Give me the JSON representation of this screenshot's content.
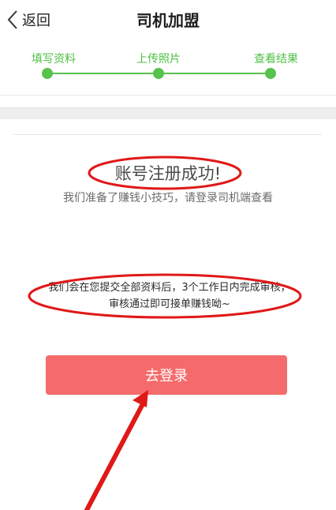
{
  "header": {
    "back_label": "返回",
    "title": "司机加盟"
  },
  "progress": {
    "steps": [
      {
        "label": "填写资料"
      },
      {
        "label": "上传照片"
      },
      {
        "label": "查看结果"
      }
    ]
  },
  "result": {
    "title": "账号注册成功!",
    "subtitle": "我们准备了赚钱小技巧，请登录司机端查看",
    "notice": "我们会在您提交全部资料后，3个工作日内完成审核，审核通过即可接单赚钱呦~"
  },
  "actions": {
    "login_label": "去登录"
  },
  "colors": {
    "accent_green": "#58c24e",
    "button_red": "#f56b6b",
    "annotation_red": "#e01818"
  }
}
